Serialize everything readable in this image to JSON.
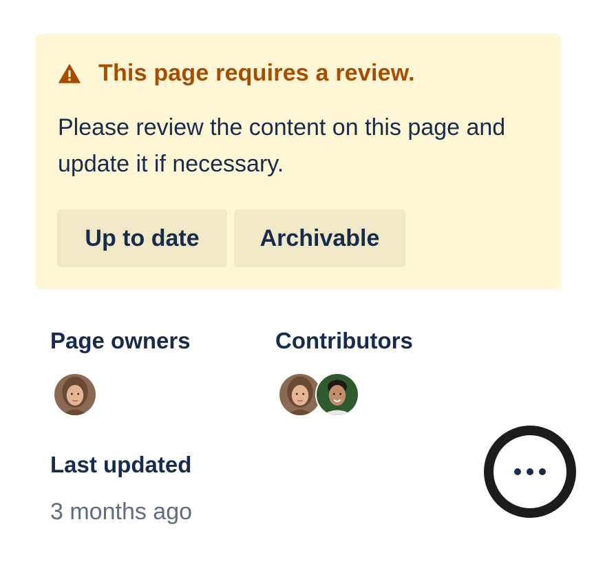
{
  "banner": {
    "title": "This page requires a review.",
    "body": "Please review the content on this page and update it if necessary.",
    "buttons": [
      {
        "label": "Up to date"
      },
      {
        "label": "Archivable"
      }
    ],
    "icon": "warning-icon",
    "background_color": "#fff6d6",
    "title_color": "#a64d00"
  },
  "owners": {
    "label": "Page owners",
    "avatars": [
      "avatar-woman"
    ]
  },
  "contributors": {
    "label": "Contributors",
    "avatars": [
      "avatar-woman",
      "avatar-man"
    ]
  },
  "last_updated": {
    "label": "Last updated",
    "value": "3 months ago"
  },
  "more_button": {
    "icon": "more-horizontal-icon"
  }
}
